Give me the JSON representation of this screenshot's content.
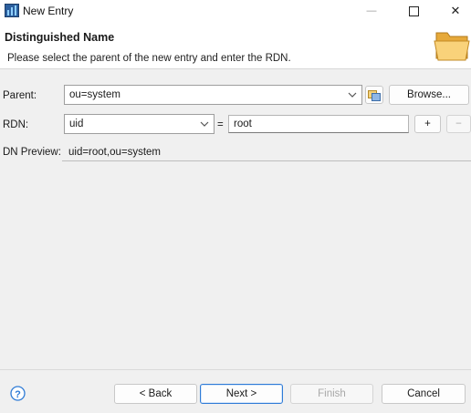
{
  "window": {
    "title": "New Entry",
    "minimize_glyph": "—",
    "maximize_glyph": "☐",
    "close_glyph": "✕"
  },
  "header": {
    "title": "Distinguished Name",
    "description": "Please select the parent of the new entry and enter the RDN."
  },
  "form": {
    "parent_label": "Parent:",
    "parent_value": "ou=system",
    "browse_label": "Browse...",
    "rdn_label": "RDN:",
    "rdn_attribute": "uid",
    "equals": "=",
    "rdn_value": "root",
    "add_label": "+",
    "remove_label": "−",
    "preview_label": "DN Preview:",
    "preview_value": "uid=root,ou=system"
  },
  "footer": {
    "help_glyph": "?",
    "back_label": "< Back",
    "next_label": "Next >",
    "finish_label": "Finish",
    "cancel_label": "Cancel"
  },
  "colors": {
    "accent": "#2e7bd6",
    "folder": "#f5c35a",
    "background": "#f0f0f0"
  }
}
